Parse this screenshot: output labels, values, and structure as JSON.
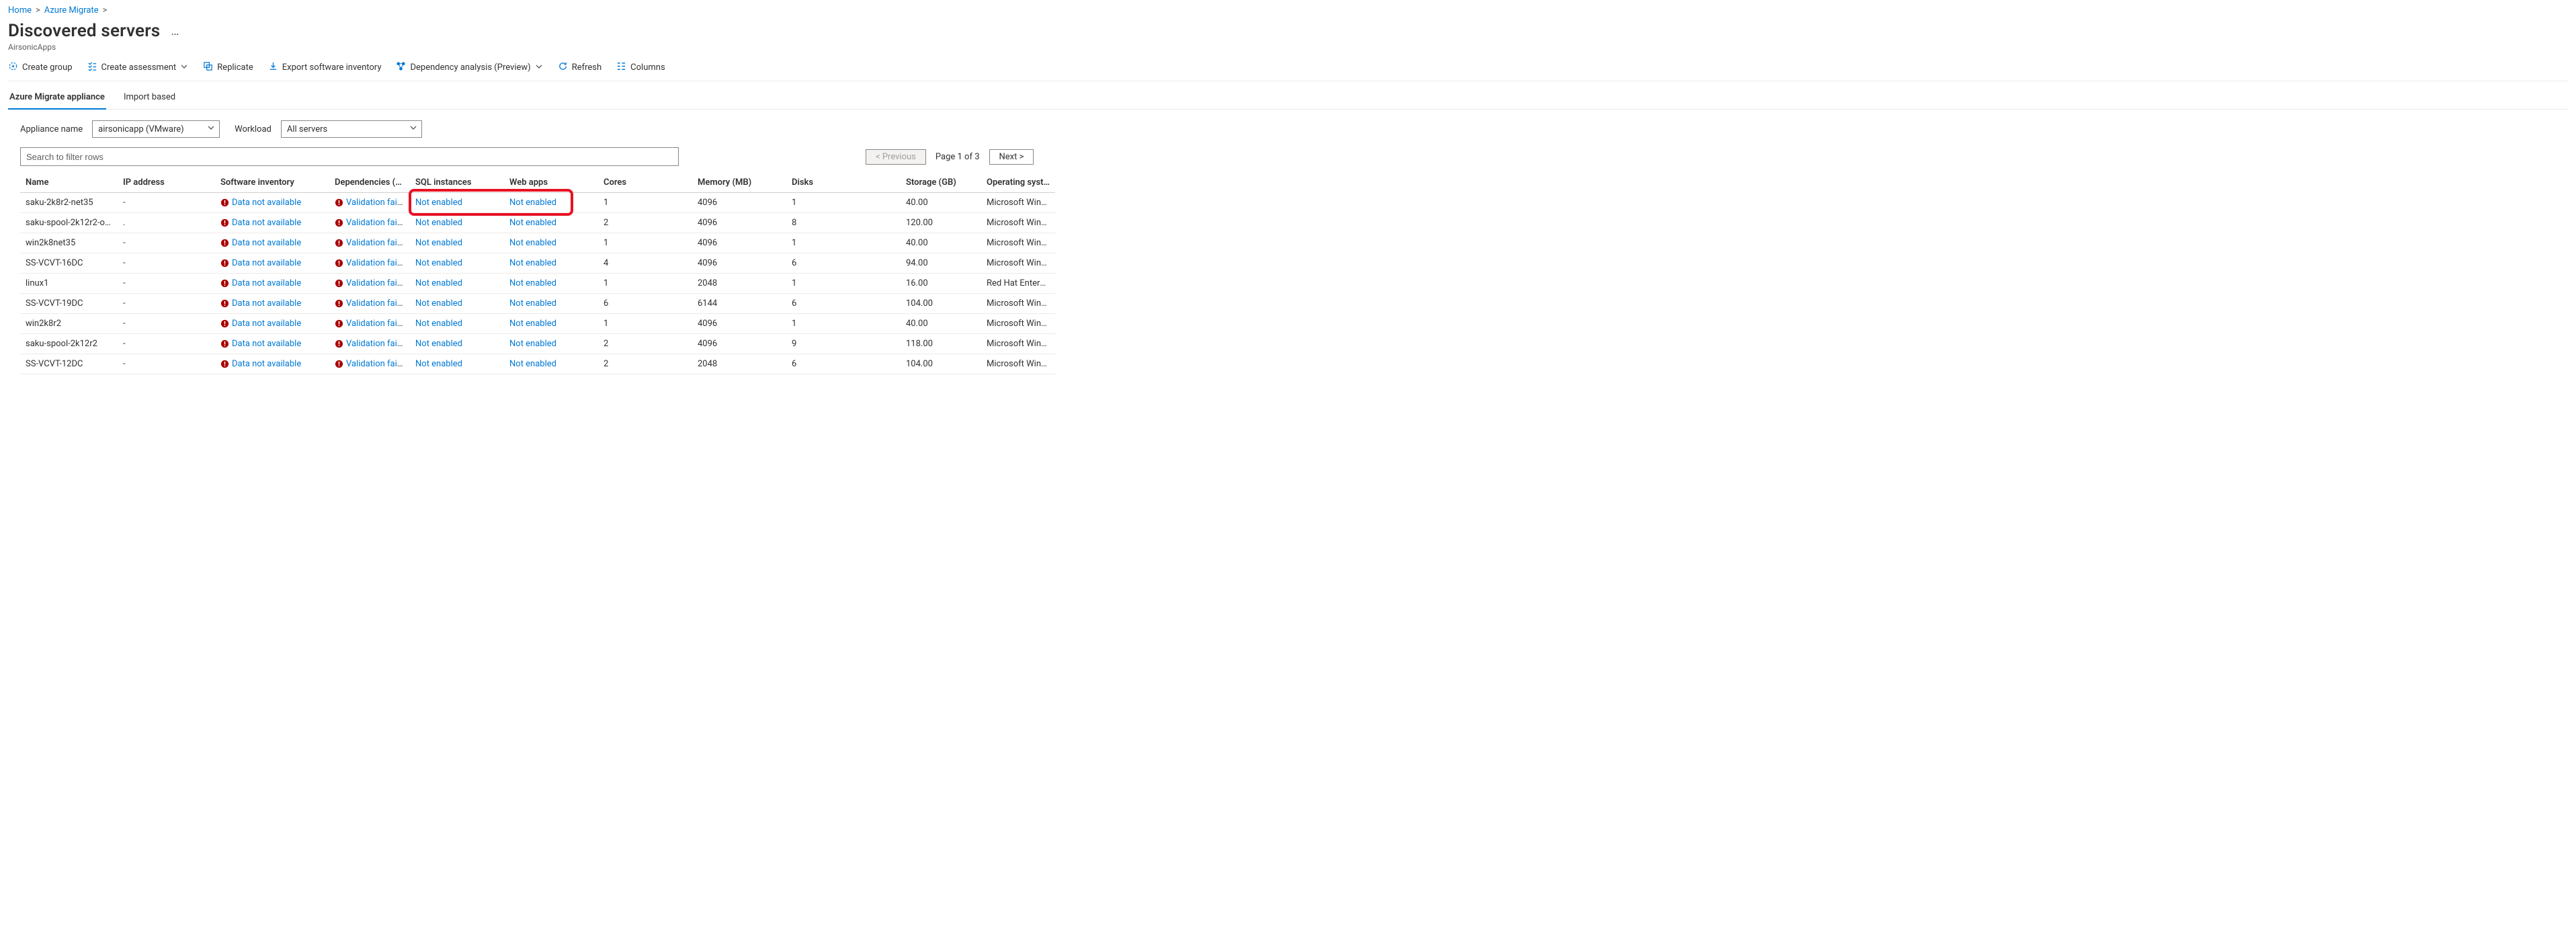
{
  "breadcrumbs": {
    "home": "Home",
    "azure_migrate": "Azure Migrate"
  },
  "page": {
    "title": "Discovered servers",
    "subtitle": "AirsonicApps"
  },
  "toolbar": {
    "create_group": "Create group",
    "create_assessment": "Create assessment",
    "replicate": "Replicate",
    "export_software_inventory": "Export software inventory",
    "dependency_analysis": "Dependency analysis (Preview)",
    "refresh": "Refresh",
    "columns": "Columns"
  },
  "tabs": {
    "appliance": "Azure Migrate appliance",
    "import_based": "Import based"
  },
  "filters": {
    "appliance_name_label": "Appliance name",
    "appliance_name_value": "airsonicapp (VMware)",
    "workload_label": "Workload",
    "workload_value": "All servers"
  },
  "search": {
    "placeholder": "Search to filter rows"
  },
  "pager": {
    "prev": "<  Previous",
    "page_text": "Page 1 of 3",
    "next": "Next  >"
  },
  "columns": {
    "name": "Name",
    "ip": "IP address",
    "software_inventory": "Software inventory",
    "dependencies": "Dependencies (Age…",
    "sql": "SQL instances",
    "web": "Web apps",
    "cores": "Cores",
    "memory": "Memory (MB)",
    "disks": "Disks",
    "storage": "Storage (GB)",
    "os": "Operating system"
  },
  "cell_labels": {
    "data_not_available": "Data not available",
    "validation_failed": "Validation failed",
    "not_enabled": "Not enabled"
  },
  "rows": [
    {
      "name": "saku-2k8r2-net35",
      "ip": "-",
      "cores": "1",
      "memory": "4096",
      "disks": "1",
      "storage": "40.00",
      "os": "Microsoft Windows"
    },
    {
      "name": "saku-spool-2k12r2-o…",
      "ip": ".",
      "cores": "2",
      "memory": "4096",
      "disks": "8",
      "storage": "120.00",
      "os": "Microsoft Windows"
    },
    {
      "name": "win2k8net35",
      "ip": "-",
      "cores": "1",
      "memory": "4096",
      "disks": "1",
      "storage": "40.00",
      "os": "Microsoft Windows"
    },
    {
      "name": "SS-VCVT-16DC",
      "ip": "-",
      "cores": "4",
      "memory": "4096",
      "disks": "6",
      "storage": "94.00",
      "os": "Microsoft Windows"
    },
    {
      "name": "linux1",
      "ip": "-",
      "cores": "1",
      "memory": "2048",
      "disks": "1",
      "storage": "16.00",
      "os": "Red Hat Enterprise"
    },
    {
      "name": "SS-VCVT-19DC",
      "ip": "-",
      "cores": "6",
      "memory": "6144",
      "disks": "6",
      "storage": "104.00",
      "os": "Microsoft Windows"
    },
    {
      "name": "win2k8r2",
      "ip": "-",
      "cores": "1",
      "memory": "4096",
      "disks": "1",
      "storage": "40.00",
      "os": "Microsoft Windows"
    },
    {
      "name": "saku-spool-2k12r2",
      "ip": "-",
      "cores": "2",
      "memory": "4096",
      "disks": "9",
      "storage": "118.00",
      "os": "Microsoft Windows"
    },
    {
      "name": "SS-VCVT-12DC",
      "ip": "-",
      "cores": "2",
      "memory": "2048",
      "disks": "6",
      "storage": "104.00",
      "os": "Microsoft Windows"
    }
  ]
}
